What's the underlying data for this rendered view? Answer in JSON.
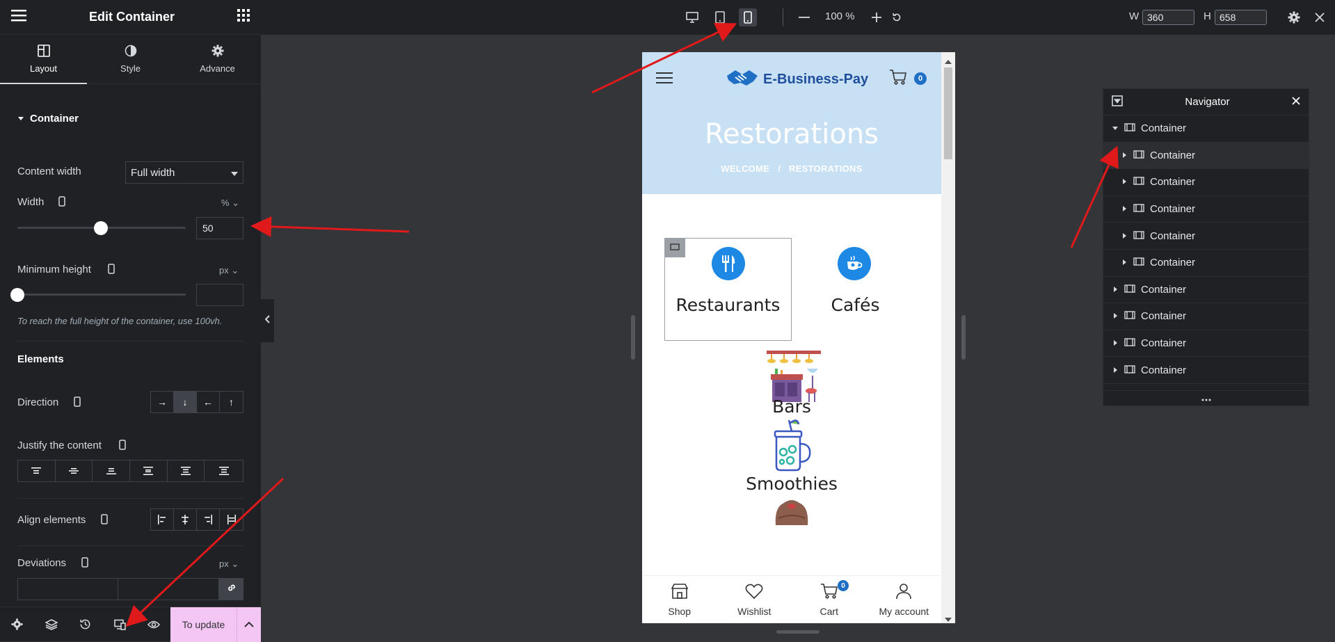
{
  "editor": {
    "header_title": "Edit Container",
    "tabs": [
      {
        "label": "Layout",
        "icon": "layout-icon",
        "active": true
      },
      {
        "label": "Style",
        "icon": "half-circle-icon",
        "active": false
      },
      {
        "label": "Advance",
        "icon": "gear-icon",
        "active": false
      }
    ],
    "section_title": "Container",
    "content_width": {
      "label": "Content width",
      "value": "Full width"
    },
    "width": {
      "label": "Width",
      "unit": "%",
      "value": "50",
      "slider_fraction": 0.5
    },
    "min_height": {
      "label": "Minimum height",
      "unit": "px",
      "value": "",
      "slider_fraction": 0
    },
    "min_height_hint": "To reach the full height of the container, use 100vh.",
    "elements_title": "Elements",
    "direction": {
      "label": "Direction",
      "options": [
        "→",
        "↓",
        "←",
        "↑"
      ],
      "selected": 1
    },
    "justify": {
      "label": "Justify the content"
    },
    "align": {
      "label": "Align elements"
    },
    "deviations": {
      "label": "Deviations",
      "unit": "px"
    },
    "update_label": "To update"
  },
  "topbar": {
    "zoom": "100 %",
    "w_label": "W",
    "w_value": "360",
    "h_label": "H",
    "h_value": "658"
  },
  "site": {
    "logo_text": "E-Business-Pay",
    "cart_count": "0",
    "hero_title": "Restorations",
    "breadcrumb_home": "WELCOME",
    "breadcrumb_sep": "/",
    "breadcrumb_current": "RESTORATIONS",
    "categories": [
      "Restaurants",
      "Cafés",
      "Bars",
      "Smoothies"
    ],
    "bottom_nav": [
      "Shop",
      "Wishlist",
      "Cart",
      "My account"
    ],
    "bottom_cart_count": "0"
  },
  "navigator": {
    "title": "Navigator",
    "items": [
      {
        "label": "Container",
        "level": 0,
        "expanded": true
      },
      {
        "label": "Container",
        "level": 1,
        "highlight": true
      },
      {
        "label": "Container",
        "level": 1
      },
      {
        "label": "Container",
        "level": 1
      },
      {
        "label": "Container",
        "level": 1
      },
      {
        "label": "Container",
        "level": 1
      },
      {
        "label": "Container",
        "level": 0
      },
      {
        "label": "Container",
        "level": 0
      },
      {
        "label": "Container",
        "level": 0
      },
      {
        "label": "Container",
        "level": 0
      }
    ]
  },
  "colors": {
    "panel_bg": "#1f2124",
    "canvas_bg": "#333538",
    "hero_bg": "#c7e0f4",
    "update_button": "#f4c6f4",
    "annotation_arrow": "#e0191b",
    "brand_blue": "#1f6fc5"
  }
}
